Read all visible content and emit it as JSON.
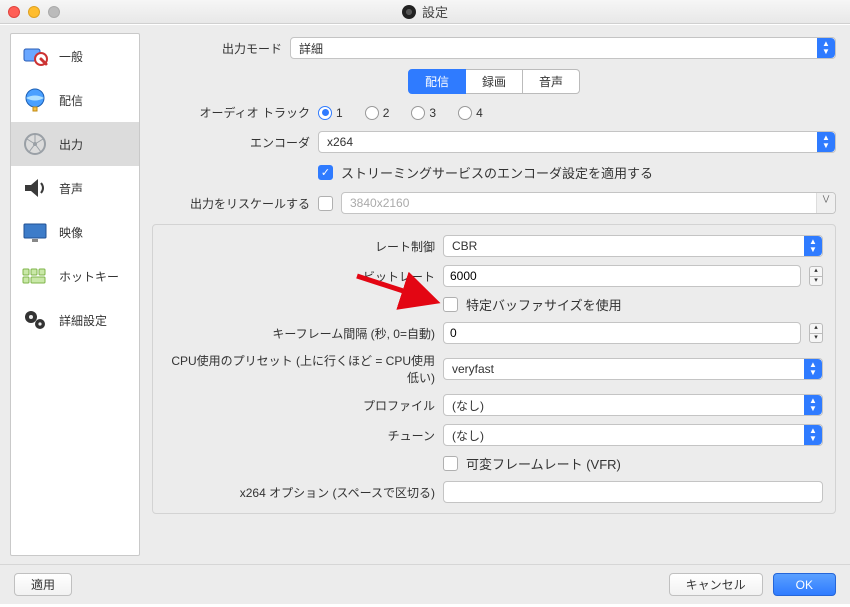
{
  "window": {
    "title": "設定"
  },
  "sidebar": {
    "items": [
      {
        "label": "一般"
      },
      {
        "label": "配信"
      },
      {
        "label": "出力"
      },
      {
        "label": "音声"
      },
      {
        "label": "映像"
      },
      {
        "label": "ホットキー"
      },
      {
        "label": "詳細設定"
      }
    ]
  },
  "top": {
    "output_mode_label": "出力モード",
    "output_mode_value": "詳細"
  },
  "tabs": {
    "streaming": "配信",
    "recording": "録画",
    "audio": "音声"
  },
  "audio_track": {
    "label": "オーディオ トラック",
    "options": [
      "1",
      "2",
      "3",
      "4"
    ]
  },
  "encoder": {
    "label": "エンコーダ",
    "value": "x264",
    "enforce_label": "ストリーミングサービスのエンコーダ設定を適用する"
  },
  "rescale": {
    "label": "出力をリスケールする",
    "placeholder": "3840x2160"
  },
  "advanced": {
    "rate_control_label": "レート制御",
    "rate_control_value": "CBR",
    "bitrate_label": "ビットレート",
    "bitrate_value": "6000",
    "custom_buffer_label": "特定バッファサイズを使用",
    "keyframe_label": "キーフレーム間隔 (秒, 0=自動)",
    "keyframe_value": "0",
    "cpu_preset_label": "CPU使用のプリセット (上に行くほど = CPU使用低い)",
    "cpu_preset_value": "veryfast",
    "profile_label": "プロファイル",
    "profile_value": "(なし)",
    "tune_label": "チューン",
    "tune_value": "(なし)",
    "vfr_label": "可変フレームレート (VFR)",
    "x264opts_label": "x264 オプション (スペースで区切る)"
  },
  "footer": {
    "apply": "適用",
    "cancel": "キャンセル",
    "ok": "OK"
  }
}
